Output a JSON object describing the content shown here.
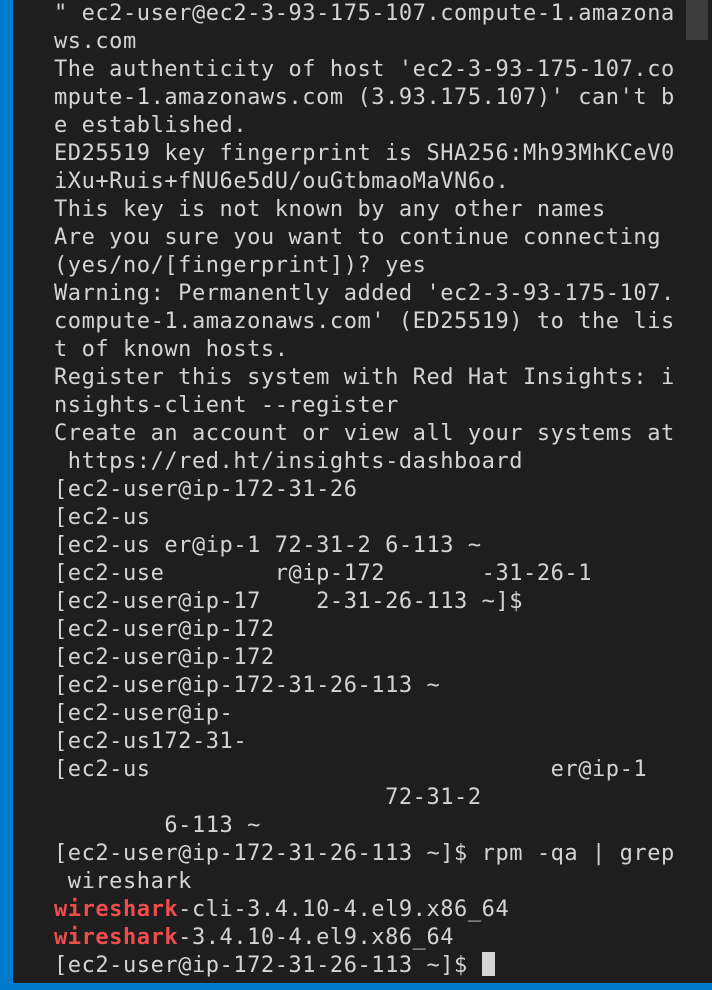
{
  "terminal": {
    "lines": [
      "\" ec2-user@ec2-3-93-175-107.compute-1.amazona",
      "ws.com",
      "The authenticity of host 'ec2-3-93-175-107.co",
      "mpute-1.amazonaws.com (3.93.175.107)' can't b",
      "e established.",
      "ED25519 key fingerprint is SHA256:Mh93MhKCeV0",
      "iXu+Ruis+fNU6e5dU/ouGtbmaoMaVN6o.",
      "This key is not known by any other names",
      "Are you sure you want to continue connecting",
      "(yes/no/[fingerprint])? yes",
      "Warning: Permanently added 'ec2-3-93-175-107.",
      "compute-1.amazonaws.com' (ED25519) to the lis",
      "t of known hosts.",
      "Register this system with Red Hat Insights: i",
      "nsights-client --register",
      "Create an account or view all your systems at",
      " https://red.ht/insights-dashboard",
      "[ec2-user@ip-172-31-26",
      "[ec2-us",
      "[ec2-us er@ip-1 72-31-2 6-113 ~",
      "[ec2-use        r@ip-172       -31-26-1",
      "[ec2-user@ip-17    2-31-26-113 ~]$",
      "[ec2-user@ip-172",
      "[ec2-user@ip-172",
      "[ec2-user@ip-172-31-26-113 ~",
      "[ec2-user@ip-",
      "[ec2-us172-31-",
      "[ec2-us                             er@ip-1",
      "                        72-31-2",
      "        6-113 ~",
      "[ec2-user@ip-172-31-26-113 ~]$ rpm -qa | grep",
      " wireshark"
    ],
    "result_lines": [
      {
        "match": "wireshark",
        "rest": "-cli-3.4.10-4.el9.x86_64"
      },
      {
        "match": "wireshark",
        "rest": "-3.4.10-4.el9.x86_64"
      }
    ],
    "prompt": "[ec2-user@ip-172-31-26-113 ~]$ ",
    "colors": {
      "background": "#1e1e1e",
      "foreground": "#d4d4d4",
      "match_highlight": "#f14c4c",
      "accent_border": "#007acc"
    }
  }
}
